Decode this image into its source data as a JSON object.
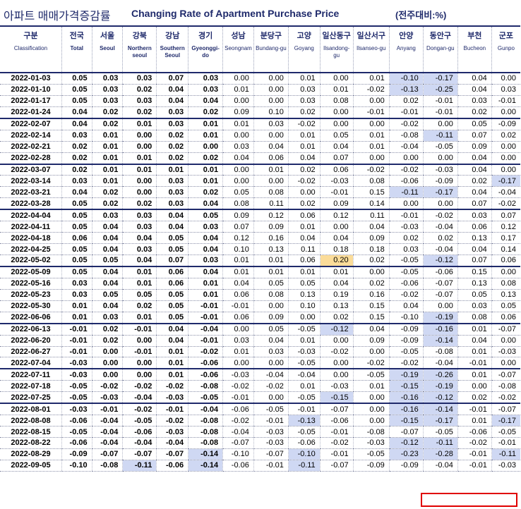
{
  "title": {
    "korean": "아파트 매매가격증감률",
    "english": "Changing Rate of Apartment Purchase Price",
    "unit": "(전주대비:%)"
  },
  "columns": [
    {
      "kr": "구분",
      "en": "Classification"
    },
    {
      "kr": "전국",
      "en": "Total"
    },
    {
      "kr": "서울",
      "en": "Seoul"
    },
    {
      "kr": "강북",
      "en": "Northern seoul"
    },
    {
      "kr": "강남",
      "en": "Southern Seoul"
    },
    {
      "kr": "경기",
      "en": "Gyeonggi-do"
    },
    {
      "kr": "성남",
      "en": "Seongnam"
    },
    {
      "kr": "분당구",
      "en": "Bundang-gu"
    },
    {
      "kr": "고양",
      "en": "Goyang"
    },
    {
      "kr": "일산동구",
      "en": "Ilsandong-gu"
    },
    {
      "kr": "일산서구",
      "en": "Ilsanseo-gu"
    },
    {
      "kr": "안양",
      "en": "Anyang"
    },
    {
      "kr": "동안구",
      "en": "Dongan-gu"
    },
    {
      "kr": "부천",
      "en": "Bucheon"
    },
    {
      "kr": "군포",
      "en": "Gunpo"
    }
  ],
  "chart_data": {
    "type": "table",
    "title": "Changing Rate of Apartment Purchase Price",
    "unit": "(전주대비:%)",
    "rows": [
      {
        "date": "2022-01-03",
        "values": [
          "0.05",
          "0.03",
          "0.03",
          "0.07",
          "0.03",
          "0.00",
          "0.00",
          "0.01",
          "0.00",
          "0.01",
          "-0.10",
          "-0.17",
          "0.04",
          "0.00"
        ]
      },
      {
        "date": "2022-01-10",
        "values": [
          "0.05",
          "0.03",
          "0.02",
          "0.04",
          "0.03",
          "0.01",
          "0.00",
          "0.03",
          "0.01",
          "-0.02",
          "-0.13",
          "-0.25",
          "0.04",
          "0.03"
        ]
      },
      {
        "date": "2022-01-17",
        "values": [
          "0.05",
          "0.03",
          "0.03",
          "0.04",
          "0.04",
          "0.00",
          "0.00",
          "0.03",
          "0.08",
          "0.00",
          "0.02",
          "-0.01",
          "0.03",
          "-0.01"
        ]
      },
      {
        "date": "2022-01-24",
        "values": [
          "0.04",
          "0.02",
          "0.02",
          "0.03",
          "0.02",
          "0.09",
          "0.10",
          "0.02",
          "0.00",
          "-0.01",
          "-0.01",
          "-0.01",
          "0.02",
          "0.00"
        ]
      },
      {
        "date": "2022-02-07",
        "values": [
          "0.04",
          "0.02",
          "0.01",
          "0.03",
          "0.01",
          "0.01",
          "0.03",
          "-0.02",
          "0.00",
          "0.00",
          "-0.02",
          "0.00",
          "0.05",
          "-0.09"
        ]
      },
      {
        "date": "2022-02-14",
        "values": [
          "0.03",
          "0.01",
          "0.00",
          "0.02",
          "0.01",
          "0.00",
          "0.00",
          "0.01",
          "0.05",
          "0.01",
          "-0.08",
          "-0.11",
          "0.07",
          "0.02"
        ]
      },
      {
        "date": "2022-02-21",
        "values": [
          "0.02",
          "0.01",
          "0.00",
          "0.02",
          "0.00",
          "0.03",
          "0.04",
          "0.01",
          "0.04",
          "0.01",
          "-0.04",
          "-0.05",
          "0.09",
          "0.00"
        ]
      },
      {
        "date": "2022-02-28",
        "values": [
          "0.02",
          "0.01",
          "0.01",
          "0.02",
          "0.02",
          "0.04",
          "0.06",
          "0.04",
          "0.07",
          "0.00",
          "0.00",
          "0.00",
          "0.04",
          "0.00"
        ]
      },
      {
        "date": "2022-03-07",
        "values": [
          "0.02",
          "0.01",
          "0.01",
          "0.01",
          "0.01",
          "0.00",
          "0.01",
          "0.02",
          "0.06",
          "-0.02",
          "-0.02",
          "-0.03",
          "0.04",
          "0.00"
        ]
      },
      {
        "date": "2022-03-14",
        "values": [
          "0.03",
          "0.01",
          "0.00",
          "0.03",
          "0.01",
          "0.00",
          "0.00",
          "-0.02",
          "-0.03",
          "0.08",
          "-0.06",
          "-0.09",
          "0.02",
          "-0.17"
        ]
      },
      {
        "date": "2022-03-21",
        "values": [
          "0.04",
          "0.02",
          "0.00",
          "0.03",
          "0.02",
          "0.05",
          "0.08",
          "0.00",
          "-0.01",
          "0.15",
          "-0.11",
          "-0.17",
          "0.04",
          "-0.04"
        ]
      },
      {
        "date": "2022-03-28",
        "values": [
          "0.05",
          "0.02",
          "0.02",
          "0.03",
          "0.04",
          "0.08",
          "0.11",
          "0.02",
          "0.09",
          "0.14",
          "0.00",
          "0.00",
          "0.07",
          "-0.02"
        ]
      },
      {
        "date": "2022-04-04",
        "values": [
          "0.05",
          "0.03",
          "0.03",
          "0.04",
          "0.05",
          "0.09",
          "0.12",
          "0.06",
          "0.12",
          "0.11",
          "-0.01",
          "-0.02",
          "0.03",
          "0.07"
        ]
      },
      {
        "date": "2022-04-11",
        "values": [
          "0.05",
          "0.04",
          "0.03",
          "0.04",
          "0.03",
          "0.07",
          "0.09",
          "0.01",
          "0.00",
          "0.04",
          "-0.03",
          "-0.04",
          "0.06",
          "0.12"
        ]
      },
      {
        "date": "2022-04-18",
        "values": [
          "0.06",
          "0.04",
          "0.04",
          "0.05",
          "0.04",
          "0.12",
          "0.16",
          "0.04",
          "0.04",
          "0.09",
          "0.02",
          "0.02",
          "0.13",
          "0.17"
        ]
      },
      {
        "date": "2022-04-25",
        "values": [
          "0.05",
          "0.04",
          "0.03",
          "0.05",
          "0.04",
          "0.10",
          "0.13",
          "0.11",
          "0.18",
          "0.18",
          "0.03",
          "-0.04",
          "0.04",
          "0.14"
        ]
      },
      {
        "date": "2022-05-02",
        "values": [
          "0.05",
          "0.05",
          "0.04",
          "0.07",
          "0.03",
          "0.01",
          "0.01",
          "0.06",
          "0.20",
          "0.02",
          "-0.05",
          "-0.12",
          "0.07",
          "0.06"
        ]
      },
      {
        "date": "2022-05-09",
        "values": [
          "0.05",
          "0.04",
          "0.01",
          "0.06",
          "0.04",
          "0.01",
          "0.01",
          "0.01",
          "0.01",
          "0.00",
          "-0.05",
          "-0.06",
          "0.15",
          "0.00"
        ]
      },
      {
        "date": "2022-05-16",
        "values": [
          "0.03",
          "0.04",
          "0.01",
          "0.06",
          "0.01",
          "0.04",
          "0.05",
          "0.05",
          "0.04",
          "0.02",
          "-0.06",
          "-0.07",
          "0.13",
          "0.08"
        ]
      },
      {
        "date": "2022-05-23",
        "values": [
          "0.03",
          "0.05",
          "0.05",
          "0.05",
          "0.01",
          "0.06",
          "0.08",
          "0.13",
          "0.19",
          "0.16",
          "-0.02",
          "-0.07",
          "0.05",
          "0.13"
        ]
      },
      {
        "date": "2022-05-30",
        "values": [
          "0.01",
          "0.04",
          "0.02",
          "0.05",
          "-0.01",
          "-0.01",
          "0.00",
          "0.10",
          "0.13",
          "0.15",
          "0.04",
          "0.00",
          "0.03",
          "0.05"
        ]
      },
      {
        "date": "2022-06-06",
        "values": [
          "0.01",
          "0.03",
          "0.01",
          "0.05",
          "-0.01",
          "0.06",
          "0.09",
          "0.00",
          "0.02",
          "0.15",
          "-0.10",
          "-0.19",
          "0.08",
          "0.06"
        ]
      },
      {
        "date": "2022-06-13",
        "values": [
          "-0.01",
          "0.02",
          "-0.01",
          "0.04",
          "-0.04",
          "0.00",
          "0.05",
          "-0.05",
          "-0.12",
          "0.04",
          "-0.09",
          "-0.16",
          "0.01",
          "-0.07"
        ]
      },
      {
        "date": "2022-06-20",
        "values": [
          "-0.01",
          "0.02",
          "0.00",
          "0.04",
          "-0.01",
          "0.03",
          "0.04",
          "0.01",
          "0.00",
          "0.09",
          "-0.09",
          "-0.14",
          "0.04",
          "0.00"
        ]
      },
      {
        "date": "2022-06-27",
        "values": [
          "-0.01",
          "0.00",
          "-0.01",
          "0.01",
          "-0.02",
          "0.01",
          "0.03",
          "-0.03",
          "-0.02",
          "0.00",
          "-0.05",
          "-0.08",
          "0.01",
          "-0.03"
        ]
      },
      {
        "date": "2022-07-04",
        "values": [
          "-0.03",
          "0.00",
          "0.00",
          "0.01",
          "-0.06",
          "0.00",
          "0.00",
          "-0.05",
          "0.00",
          "-0.02",
          "-0.02",
          "-0.04",
          "-0.01",
          "0.00"
        ]
      },
      {
        "date": "2022-07-11",
        "values": [
          "-0.03",
          "0.00",
          "0.00",
          "0.01",
          "-0.06",
          "-0.03",
          "-0.04",
          "-0.04",
          "0.00",
          "-0.05",
          "-0.19",
          "-0.26",
          "0.01",
          "-0.07"
        ]
      },
      {
        "date": "2022-07-18",
        "values": [
          "-0.05",
          "-0.02",
          "-0.02",
          "-0.02",
          "-0.08",
          "-0.02",
          "-0.02",
          "0.01",
          "-0.03",
          "0.01",
          "-0.15",
          "-0.19",
          "0.00",
          "-0.08"
        ]
      },
      {
        "date": "2022-07-25",
        "values": [
          "-0.05",
          "-0.03",
          "-0.04",
          "-0.03",
          "-0.05",
          "-0.01",
          "0.00",
          "-0.05",
          "-0.15",
          "0.00",
          "-0.16",
          "-0.12",
          "0.02",
          "-0.02"
        ]
      },
      {
        "date": "2022-08-01",
        "values": [
          "-0.03",
          "-0.01",
          "-0.02",
          "-0.01",
          "-0.04",
          "-0.06",
          "-0.05",
          "-0.01",
          "-0.07",
          "0.00",
          "-0.16",
          "-0.14",
          "-0.01",
          "-0.07"
        ]
      },
      {
        "date": "2022-08-08",
        "values": [
          "-0.06",
          "-0.04",
          "-0.05",
          "-0.02",
          "-0.08",
          "-0.02",
          "-0.01",
          "-0.13",
          "-0.06",
          "0.00",
          "-0.15",
          "-0.17",
          "0.01",
          "-0.17"
        ]
      },
      {
        "date": "2022-08-15",
        "values": [
          "-0.05",
          "-0.04",
          "-0.06",
          "-0.03",
          "-0.08",
          "-0.04",
          "-0.03",
          "-0.05",
          "-0.01",
          "-0.08",
          "-0.07",
          "-0.05",
          "-0.06",
          "-0.05"
        ]
      },
      {
        "date": "2022-08-22",
        "values": [
          "-0.06",
          "-0.04",
          "-0.04",
          "-0.04",
          "-0.08",
          "-0.07",
          "-0.03",
          "-0.06",
          "-0.02",
          "-0.03",
          "-0.12",
          "-0.11",
          "-0.02",
          "-0.01"
        ]
      },
      {
        "date": "2022-08-29",
        "values": [
          "-0.09",
          "-0.07",
          "-0.07",
          "-0.07",
          "-0.14",
          "-0.10",
          "-0.07",
          "-0.10",
          "-0.01",
          "-0.05",
          "-0.23",
          "-0.28",
          "-0.01",
          "-0.11"
        ]
      },
      {
        "date": "2022-09-05",
        "values": [
          "-0.10",
          "-0.08",
          "-0.11",
          "-0.06",
          "-0.14",
          "-0.06",
          "-0.01",
          "-0.11",
          "-0.07",
          "-0.09",
          "-0.09",
          "-0.04",
          "-0.01",
          "-0.03"
        ]
      }
    ],
    "highlights": {
      "blue": [
        [
          0,
          10
        ],
        [
          0,
          11
        ],
        [
          1,
          10
        ],
        [
          1,
          11
        ],
        [
          5,
          11
        ],
        [
          9,
          13
        ],
        [
          10,
          10
        ],
        [
          10,
          11
        ],
        [
          16,
          11
        ],
        [
          21,
          11
        ],
        [
          22,
          8
        ],
        [
          22,
          11
        ],
        [
          23,
          11
        ],
        [
          26,
          10
        ],
        [
          26,
          11
        ],
        [
          27,
          10
        ],
        [
          27,
          11
        ],
        [
          28,
          8
        ],
        [
          28,
          10
        ],
        [
          28,
          11
        ],
        [
          29,
          10
        ],
        [
          29,
          11
        ],
        [
          30,
          7
        ],
        [
          30,
          10
        ],
        [
          30,
          11
        ],
        [
          30,
          13
        ],
        [
          32,
          10
        ],
        [
          32,
          11
        ],
        [
          33,
          4
        ],
        [
          33,
          7
        ],
        [
          33,
          10
        ],
        [
          33,
          11
        ],
        [
          33,
          13
        ],
        [
          34,
          2
        ],
        [
          34,
          4
        ],
        [
          34,
          7
        ]
      ],
      "orange": [
        [
          16,
          8
        ]
      ],
      "bold_columns": [
        0,
        1,
        2,
        3,
        4
      ]
    },
    "month_start_rows": [
      4,
      8,
      12,
      17,
      22,
      26,
      29
    ],
    "colors": {
      "header": "#1f2a6b",
      "blue_highlight": "#cfd8f3",
      "orange_highlight": "#fbdc99",
      "box": "#e00000"
    }
  }
}
